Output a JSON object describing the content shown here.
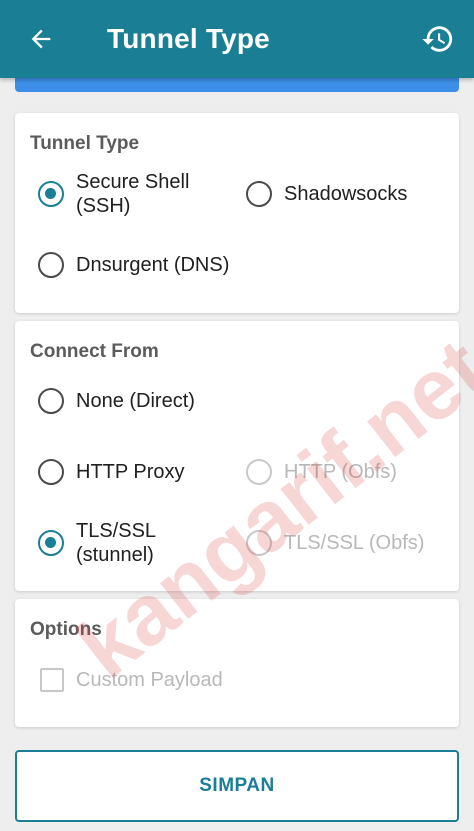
{
  "header": {
    "title": "Tunnel Type",
    "back_icon": "arrow-back-icon",
    "history_icon": "history-icon"
  },
  "colors": {
    "primary": "#1a7f94",
    "strip": "#3d8ee8",
    "disabled": "#b8b8b8"
  },
  "tunnel_type": {
    "title": "Tunnel Type",
    "options": [
      {
        "label": "Secure Shell\n(SSH)",
        "checked": true
      },
      {
        "label": "Shadowsocks",
        "checked": false
      },
      {
        "label": "Dnsurgent (DNS)",
        "checked": false
      }
    ]
  },
  "connect_from": {
    "title": "Connect From",
    "options": [
      {
        "label": "None (Direct)",
        "checked": false,
        "enabled": true
      },
      {
        "label": "HTTP Proxy",
        "checked": false,
        "enabled": true
      },
      {
        "label": "HTTP (Obfs)",
        "checked": false,
        "enabled": false
      },
      {
        "label": "TLS/SSL\n(stunnel)",
        "checked": true,
        "enabled": true
      },
      {
        "label": "TLS/SSL (Obfs)",
        "checked": false,
        "enabled": false
      }
    ]
  },
  "options": {
    "title": "Options",
    "custom_payload": {
      "label": "Custom Payload",
      "checked": false,
      "enabled": false
    }
  },
  "save_label": "SIMPAN",
  "watermark": "kangarif.net"
}
